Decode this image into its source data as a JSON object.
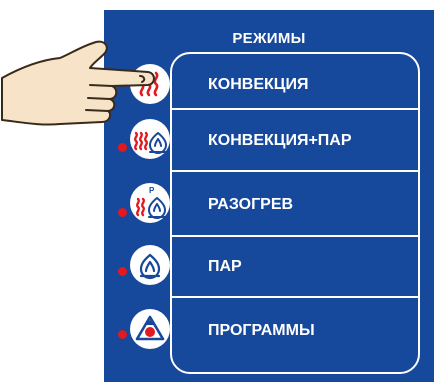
{
  "panel": {
    "title": "РЕЖИМЫ",
    "color": "#16489b"
  },
  "modes": [
    {
      "label": "КОНВЕКЦИЯ",
      "icon": "convection-icon",
      "indicator": false
    },
    {
      "label": "КОНВЕКЦИЯ+ПАР",
      "icon": "convection-steam-icon",
      "indicator": true
    },
    {
      "label": "РАЗОГРЕВ",
      "icon": "preheat-icon",
      "icon_letter": "P",
      "indicator": true
    },
    {
      "label": "ПАР",
      "icon": "steam-icon",
      "indicator": true
    },
    {
      "label": "ПРОГРАММЫ",
      "icon": "programs-icon",
      "indicator": true
    }
  ],
  "colors": {
    "accent_red": "#e2191f",
    "icon_blue": "#16489b",
    "text": "#ffffff"
  },
  "pointer": "hand-pointer-icon"
}
